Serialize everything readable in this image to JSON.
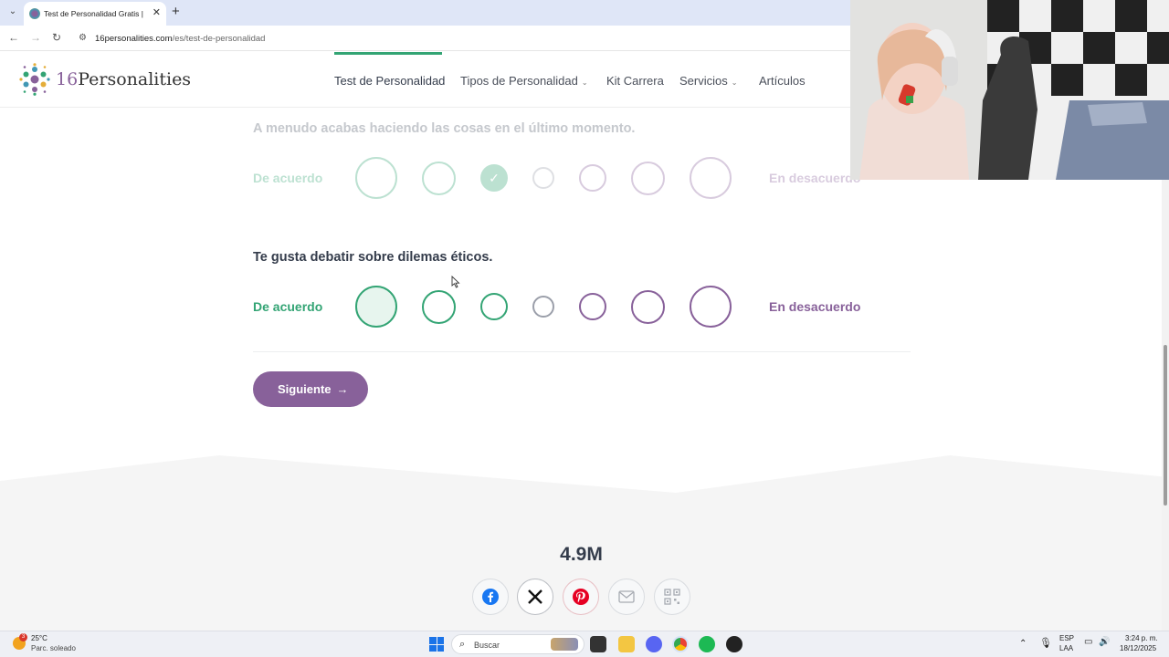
{
  "browser": {
    "tab_title": "Test de Personalidad Gratis | 16",
    "tab_close": "✕",
    "new_tab": "+",
    "url_domain": "16personalities.com",
    "url_path": "/es/test-de-personalidad"
  },
  "header": {
    "logo_number": "16",
    "logo_word": "Personalities",
    "nav": [
      {
        "label": "Test de Personalidad",
        "active": true
      },
      {
        "label": "Tipos de Personalidad",
        "dropdown": true
      },
      {
        "label": "Kit Carrera"
      },
      {
        "label": "Servicios",
        "dropdown": true
      },
      {
        "label": "Artículos"
      }
    ]
  },
  "questions": [
    {
      "text": "A menudo acabas haciendo las cosas en el último momento.",
      "agree": "De acuerdo",
      "disagree": "En desacuerdo",
      "selected_index": 2,
      "faded": true
    },
    {
      "text": "Te gusta debatir sobre dilemas éticos.",
      "agree": "De acuerdo",
      "disagree": "En desacuerdo",
      "selected_index": null,
      "faded": false
    }
  ],
  "next_button": {
    "label": "Siguiente",
    "arrow": "→"
  },
  "footer": {
    "count": "4.9M",
    "share": [
      "facebook-icon",
      "x-icon",
      "pinterest-icon",
      "email-icon",
      "qr-code-icon"
    ]
  },
  "taskbar": {
    "weather_temp": "25°C",
    "weather_desc": "Parc. soleado",
    "weather_badge": "3",
    "search_label": "Buscar",
    "lang_1": "ESP",
    "lang_2": "LAA",
    "time": "3:24 p. m.",
    "date": "18/12/2025"
  },
  "colors": {
    "agree": "#33a474",
    "disagree": "#88619a",
    "neutral": "#9b9faa",
    "button": "#88619a"
  }
}
